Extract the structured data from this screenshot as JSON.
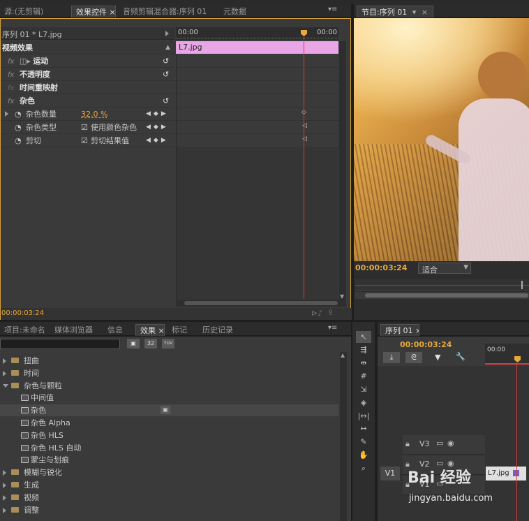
{
  "top_tabs_left": [
    {
      "label": "源:(无剪辑)"
    },
    {
      "label": "效果控件 ×"
    },
    {
      "label": "音频剪辑混合器:序列 01"
    },
    {
      "label": "元数据"
    }
  ],
  "program_tab": {
    "label": "节目:序列 01"
  },
  "effect_controls": {
    "clip_label": "序列 01 * L7.jpg",
    "section_title": "视频效果",
    "timecode_left": "00:00",
    "timecode_right": "00:00",
    "clip_bar_label": "L7.jpg",
    "effects": [
      {
        "fx": "fx",
        "name": "运动"
      },
      {
        "fx": "fx",
        "name": "不透明度"
      },
      {
        "fx": "fx",
        "name": "时间重映射"
      },
      {
        "fx": "fx",
        "name": "杂色"
      }
    ],
    "params": [
      {
        "name": "杂色数量",
        "value": "32.0 %"
      },
      {
        "name": "杂色类型",
        "value": "使用颜色杂色"
      },
      {
        "name": "剪切",
        "value": "剪切结果值"
      }
    ],
    "current_time": "00:00:03:24"
  },
  "program_monitor": {
    "timecode": "00:00:03:24",
    "fit_label": "适合"
  },
  "bottom_tabs_left": [
    {
      "label": "项目:未命名"
    },
    {
      "label": "媒体浏览器"
    },
    {
      "label": "信息"
    },
    {
      "label": "效果 ×"
    },
    {
      "label": "标记"
    },
    {
      "label": "历史记录"
    }
  ],
  "effects_browser": {
    "items": [
      {
        "indent": 0,
        "type": "folder",
        "open": false,
        "label": "扭曲"
      },
      {
        "indent": 0,
        "type": "folder",
        "open": false,
        "label": "时间"
      },
      {
        "indent": 0,
        "type": "folder",
        "open": true,
        "label": "杂色与颗粒"
      },
      {
        "indent": 1,
        "type": "effect",
        "label": "中间值"
      },
      {
        "indent": 1,
        "type": "effect",
        "label": "杂色",
        "selected": true
      },
      {
        "indent": 1,
        "type": "effect",
        "label": "杂色 Alpha"
      },
      {
        "indent": 1,
        "type": "effect",
        "label": "杂色 HLS"
      },
      {
        "indent": 1,
        "type": "effect",
        "label": "杂色 HLS 自动"
      },
      {
        "indent": 1,
        "type": "effect",
        "label": "蒙尘与划痕"
      },
      {
        "indent": 0,
        "type": "folder",
        "open": false,
        "label": "模糊与锐化"
      },
      {
        "indent": 0,
        "type": "folder",
        "open": false,
        "label": "生成"
      },
      {
        "indent": 0,
        "type": "folder",
        "open": false,
        "label": "视频"
      },
      {
        "indent": 0,
        "type": "folder",
        "open": false,
        "label": "调整"
      }
    ],
    "icon_labels": [
      "32",
      "YUV"
    ]
  },
  "timeline": {
    "tab_label": "序列 01 ×",
    "timecode": "00:00:03:24",
    "ruler_start": "00:00",
    "tracks": [
      {
        "name": "V3"
      },
      {
        "name": "V2"
      },
      {
        "name": "V1",
        "source": "V1"
      }
    ],
    "clip_label": "L7.jpg"
  },
  "watermark": {
    "text": "Bai 经验",
    "sub": "jingyan.baidu.com"
  },
  "colors": {
    "accent": "#e8a83a",
    "clip_pink": "#e9a6e6",
    "playhead": "#d83a3a"
  }
}
